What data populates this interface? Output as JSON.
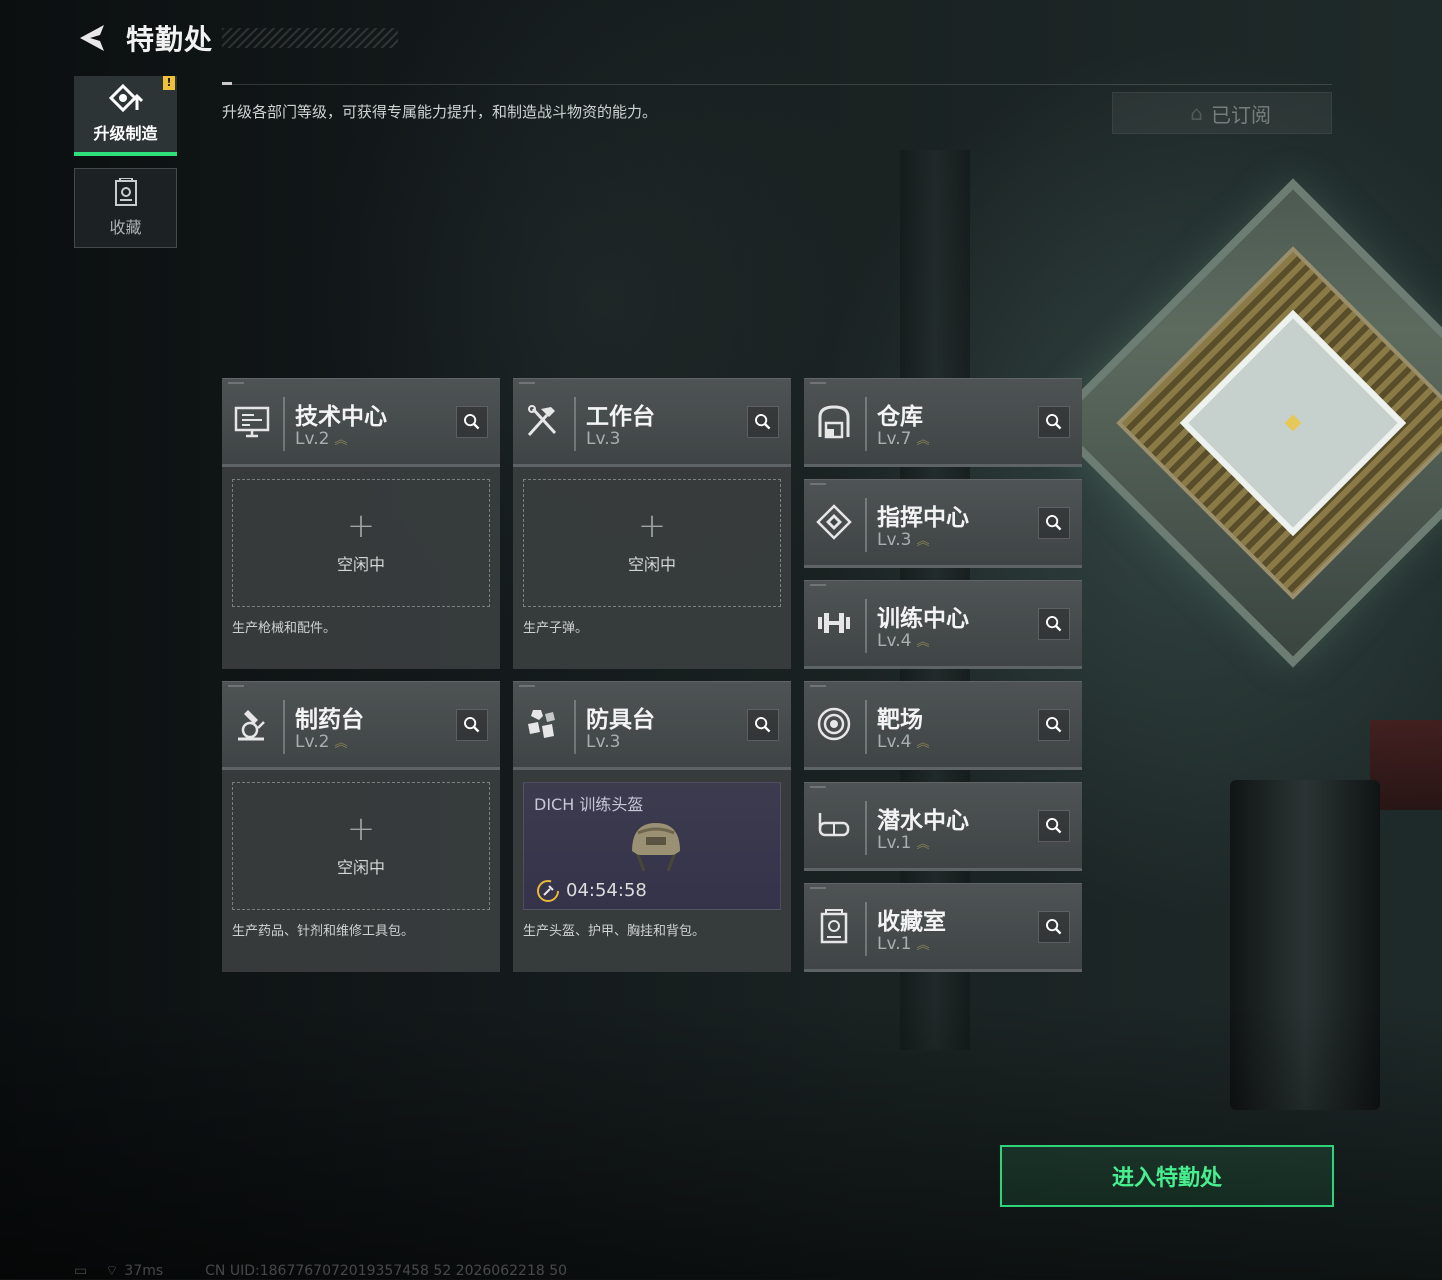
{
  "header": {
    "title": "特勤处",
    "description": "升级各部门等级，可获得专属能力提升，和制造战斗物资的能力。",
    "subscribed_label": "已订阅"
  },
  "sidebar": {
    "tabs": [
      {
        "label": "升级制造",
        "icon": "upgrade-icon",
        "active": true,
        "badge": "!"
      },
      {
        "label": "收藏",
        "icon": "collection-icon",
        "active": false
      }
    ]
  },
  "production": [
    {
      "name": "技术中心",
      "level": "Lv.2",
      "icon": "monitor-icon",
      "slot": {
        "status": "empty",
        "label": "空闲中"
      },
      "desc": "生产枪械和配件。"
    },
    {
      "name": "工作台",
      "level": "Lv.3",
      "icon": "tools-icon",
      "slot": {
        "status": "empty",
        "label": "空闲中"
      },
      "desc": "生产子弹。"
    },
    {
      "name": "制药台",
      "level": "Lv.2",
      "icon": "microscope-icon",
      "slot": {
        "status": "empty",
        "label": "空闲中"
      },
      "desc": "生产药品、针剂和维修工具包。"
    },
    {
      "name": "防具台",
      "level": "Lv.3",
      "icon": "armor-icon",
      "slot": {
        "status": "busy",
        "item": "DICH 训练头盔",
        "timer": "04:54:58"
      },
      "desc": "生产头盔、护甲、胸挂和背包。"
    }
  ],
  "facilities": [
    {
      "name": "仓库",
      "level": "Lv.7",
      "icon": "warehouse-icon"
    },
    {
      "name": "指挥中心",
      "level": "Lv.3",
      "icon": "command-icon"
    },
    {
      "name": "训练中心",
      "level": "Lv.4",
      "icon": "dumbbell-icon"
    },
    {
      "name": "靶场",
      "level": "Lv.4",
      "icon": "target-icon"
    },
    {
      "name": "潜水中心",
      "level": "Lv.1",
      "icon": "diving-icon"
    },
    {
      "name": "收藏室",
      "level": "Lv.1",
      "icon": "collection-room-icon"
    }
  ],
  "enter_button": "进入特勤处",
  "footer": {
    "ping": "37ms",
    "uid": "CN UID:1867767072019357458 52 2026062218 50"
  },
  "colors": {
    "accent": "#2fd37a",
    "badge": "#f0c23a",
    "level_chevron": "#8a8456"
  }
}
